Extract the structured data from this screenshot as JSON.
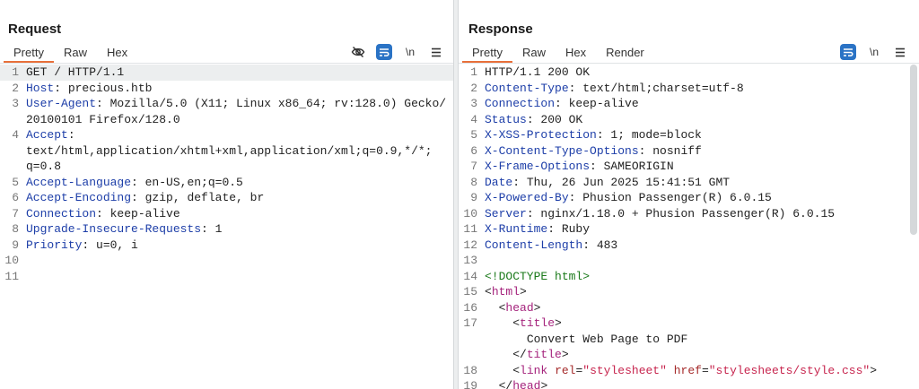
{
  "layout_toggle": [
    "side-by-side",
    "stacked",
    "single"
  ],
  "request": {
    "title": "Request",
    "tabs": [
      "Pretty",
      "Raw",
      "Hex"
    ],
    "active_tab": "Pretty",
    "tools": [
      "hide-icon",
      "wrap-icon",
      "\\n",
      "menu-icon"
    ],
    "lines": [
      {
        "n": "1",
        "parts": [
          {
            "t": "GET / HTTP/1.1"
          }
        ],
        "highlight": true
      },
      {
        "n": "2",
        "parts": [
          {
            "t": "Host",
            "c": "hn"
          },
          {
            "t": ": precious.htb"
          }
        ]
      },
      {
        "n": "3",
        "parts": [
          {
            "t": "User-Agent",
            "c": "hn"
          },
          {
            "t": ": Mozilla/5.0 (X11; Linux x86_64; rv:128.0) Gecko/20100101 Firefox/128.0"
          }
        ]
      },
      {
        "n": "4",
        "parts": [
          {
            "t": "Accept",
            "c": "hn"
          },
          {
            "t": ":\ntext/html,application/xhtml+xml,application/xml;q=0.9,*/*;\nq=0.8"
          }
        ]
      },
      {
        "n": "5",
        "parts": [
          {
            "t": "Accept-Language",
            "c": "hn"
          },
          {
            "t": ": en-US,en;q=0.5"
          }
        ]
      },
      {
        "n": "6",
        "parts": [
          {
            "t": "Accept-Encoding",
            "c": "hn"
          },
          {
            "t": ": gzip, deflate, br"
          }
        ]
      },
      {
        "n": "7",
        "parts": [
          {
            "t": "Connection",
            "c": "hn"
          },
          {
            "t": ": keep-alive"
          }
        ]
      },
      {
        "n": "8",
        "parts": [
          {
            "t": "Upgrade-Insecure-Requests",
            "c": "hn"
          },
          {
            "t": ": 1"
          }
        ]
      },
      {
        "n": "9",
        "parts": [
          {
            "t": "Priority",
            "c": "hn"
          },
          {
            "t": ": u=0, i"
          }
        ]
      },
      {
        "n": "10",
        "parts": [
          {
            "t": ""
          }
        ]
      },
      {
        "n": "11",
        "parts": [
          {
            "t": ""
          }
        ]
      }
    ]
  },
  "response": {
    "title": "Response",
    "tabs": [
      "Pretty",
      "Raw",
      "Hex",
      "Render"
    ],
    "active_tab": "Pretty",
    "tools": [
      "wrap-icon",
      "\\n",
      "menu-icon"
    ],
    "lines": [
      {
        "n": "1",
        "parts": [
          {
            "t": "HTTP/1.1 200 OK"
          }
        ]
      },
      {
        "n": "2",
        "parts": [
          {
            "t": "Content-Type",
            "c": "hn"
          },
          {
            "t": ": text/html;charset=utf-8"
          }
        ]
      },
      {
        "n": "3",
        "parts": [
          {
            "t": "Connection",
            "c": "hn"
          },
          {
            "t": ": keep-alive"
          }
        ]
      },
      {
        "n": "4",
        "parts": [
          {
            "t": "Status",
            "c": "hn"
          },
          {
            "t": ": 200 OK"
          }
        ]
      },
      {
        "n": "5",
        "parts": [
          {
            "t": "X-XSS-Protection",
            "c": "hn"
          },
          {
            "t": ": 1; mode=block"
          }
        ]
      },
      {
        "n": "6",
        "parts": [
          {
            "t": "X-Content-Type-Options",
            "c": "hn"
          },
          {
            "t": ": nosniff"
          }
        ]
      },
      {
        "n": "7",
        "parts": [
          {
            "t": "X-Frame-Options",
            "c": "hn"
          },
          {
            "t": ": SAMEORIGIN"
          }
        ]
      },
      {
        "n": "8",
        "parts": [
          {
            "t": "Date",
            "c": "hn"
          },
          {
            "t": ": Thu, 26 Jun 2025 15:41:51 GMT"
          }
        ]
      },
      {
        "n": "9",
        "parts": [
          {
            "t": "X-Powered-By",
            "c": "hn"
          },
          {
            "t": ": Phusion Passenger(R) 6.0.15"
          }
        ]
      },
      {
        "n": "10",
        "parts": [
          {
            "t": "Server",
            "c": "hn"
          },
          {
            "t": ": nginx/1.18.0 + Phusion Passenger(R) 6.0.15"
          }
        ]
      },
      {
        "n": "11",
        "parts": [
          {
            "t": "X-Runtime",
            "c": "hn"
          },
          {
            "t": ": Ruby"
          }
        ]
      },
      {
        "n": "12",
        "parts": [
          {
            "t": "Content-Length",
            "c": "hn"
          },
          {
            "t": ": 483"
          }
        ]
      },
      {
        "n": "13",
        "parts": [
          {
            "t": ""
          }
        ]
      },
      {
        "n": "14",
        "parts": [
          {
            "t": "<!DOCTYPE html>",
            "c": "decl"
          }
        ]
      },
      {
        "n": "15",
        "parts": [
          {
            "t": "<"
          },
          {
            "t": "html",
            "c": "tag"
          },
          {
            "t": ">"
          }
        ]
      },
      {
        "n": "16",
        "parts": [
          {
            "t": "  <"
          },
          {
            "t": "head",
            "c": "tag"
          },
          {
            "t": ">"
          }
        ]
      },
      {
        "n": "17",
        "parts": [
          {
            "t": "    <"
          },
          {
            "t": "title",
            "c": "tag"
          },
          {
            "t": ">\n      Convert Web Page to PDF\n    </"
          },
          {
            "t": "title",
            "c": "tag"
          },
          {
            "t": ">"
          }
        ]
      },
      {
        "n": "18",
        "parts": [
          {
            "t": "    <"
          },
          {
            "t": "link",
            "c": "tag"
          },
          {
            "t": " "
          },
          {
            "t": "rel",
            "c": "attr"
          },
          {
            "t": "="
          },
          {
            "t": "\"stylesheet\"",
            "c": "str"
          },
          {
            "t": " "
          },
          {
            "t": "href",
            "c": "attr"
          },
          {
            "t": "="
          },
          {
            "t": "\"stylesheets/style.css\"",
            "c": "str"
          },
          {
            "t": ">"
          }
        ]
      },
      {
        "n": "19",
        "parts": [
          {
            "t": "  </"
          },
          {
            "t": "head",
            "c": "tag"
          },
          {
            "t": ">"
          }
        ]
      }
    ]
  }
}
